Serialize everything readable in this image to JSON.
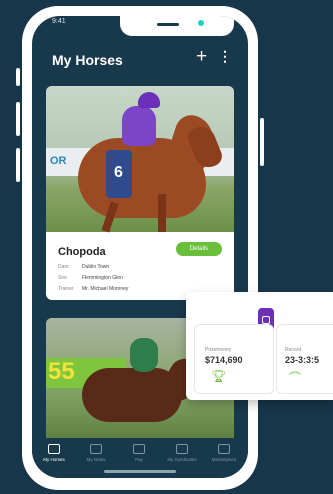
{
  "status": {
    "time": "9:41",
    "icons": "▪▪ ≋ ▭"
  },
  "header": {
    "title": "My Horses",
    "add_symbol": "+",
    "more_symbol": "⋮"
  },
  "horse_card": {
    "name": "Chopoda",
    "button_label": "Details",
    "rows": [
      {
        "label": "Dam",
        "value": "Dublin Town"
      },
      {
        "label": "Sire",
        "value": "Flemmington Glen"
      },
      {
        "label": "Trainer",
        "value": "Mr. Michael Moroney"
      }
    ]
  },
  "tabbar": {
    "items": [
      {
        "label": "My Horses",
        "active": true
      },
      {
        "label": "My Notes",
        "active": false
      },
      {
        "label": "Pay",
        "active": false
      },
      {
        "label": "My Syndicates",
        "active": false
      },
      {
        "label": "Marketplace",
        "active": false
      }
    ]
  },
  "stats": {
    "prizemoney_label": "Prizemoney",
    "prizemoney_value": "$714,690",
    "record_label": "Record",
    "record_value": "23-3:3:5"
  },
  "photo_text": {
    "rail": "OR",
    "saddle_number": "6",
    "banner": "55"
  },
  "colors": {
    "background": "#17364a",
    "accent": "#6bbd3c",
    "purple": "#6b2fb8",
    "teal": "#19d1c2"
  }
}
